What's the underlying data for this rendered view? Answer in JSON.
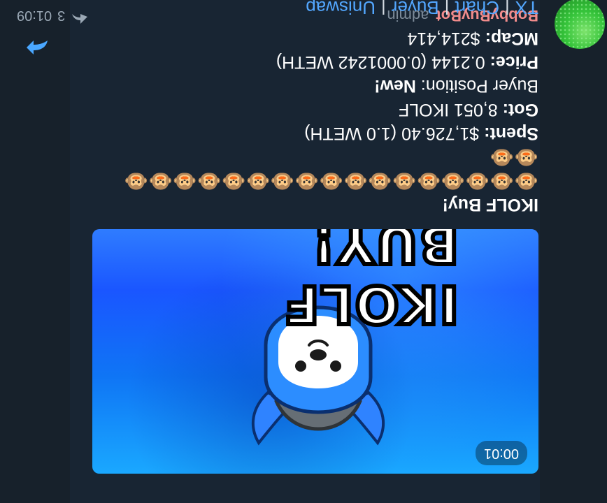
{
  "message": {
    "sender": "BobbyBuyBot",
    "role": "admin",
    "meta_count": "3",
    "time": "01:09",
    "media_badge": "00:01",
    "media_title": "IKOLF BUY!",
    "title": "IKOLF Buy!",
    "emoji_line1": "🐵🐵🐵🐵🐵🐵🐵🐵🐵🐵🐵🐵🐵🐵🐵🐵🐵",
    "emoji_line2": "🐵🐵",
    "spent_label": "Spent:",
    "spent_value": "$1,726.40 (1.0 WETH)",
    "got_label": "Got:",
    "got_value": "8,051 IKOLF",
    "position_label": "Buyer Position:",
    "position_value": "New!",
    "price_label": "Price:",
    "price_value": "0.2144 (0.0001242 WETH)",
    "mcap_label": "MCap:",
    "mcap_value": "$214,414",
    "links": [
      "TX",
      "Chart",
      "Buyer",
      "Uniswap"
    ]
  },
  "colors": {
    "bg": "#17212b",
    "bubble": "#182533",
    "sender": "#f28c8c",
    "link": "#53a7ff"
  },
  "icons": {
    "avatar": "bot-avatar",
    "share": "share-arrow-icon",
    "forward": "forward-icon"
  }
}
